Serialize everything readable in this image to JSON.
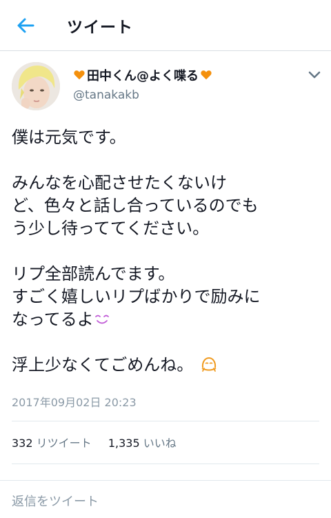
{
  "header": {
    "title": "ツイート"
  },
  "user": {
    "display_name": "田中くん@よく喋る",
    "handle": "@tanakakb"
  },
  "tweet": {
    "lines": [
      "僕は元気です。",
      "",
      "みんなを心配させたくないけ",
      "ど、色々と話し合っているのでも",
      "う少し待っててください。",
      "",
      "リプ全部読んでます。",
      "すごく嬉しいリプばかりで励みに",
      "なってるよ",
      "",
      "浮上少なくてごめんね。"
    ],
    "timestamp": "2017年09月02日 20:23"
  },
  "stats": {
    "retweets_count": "332",
    "retweets_label": "リツイート",
    "likes_count": "1,335",
    "likes_label": "いいね"
  },
  "reply": {
    "placeholder": "返信をツイート"
  },
  "colors": {
    "accent": "#1da1f2",
    "heart": "#f4900c",
    "secondary_text": "#657786",
    "divider": "#e1e8ed"
  }
}
